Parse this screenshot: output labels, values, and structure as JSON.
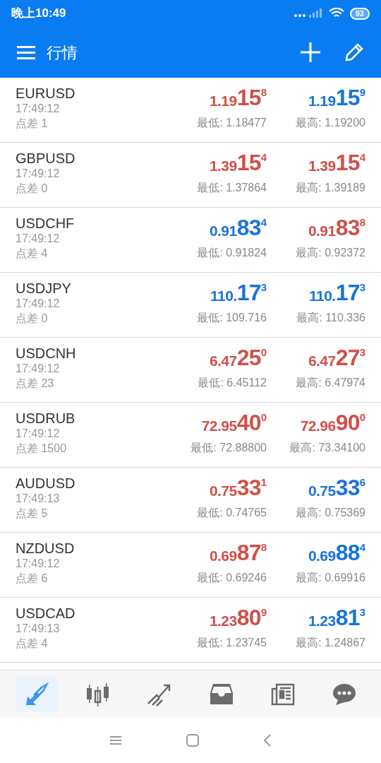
{
  "status_bar": {
    "time": "晚上10:49",
    "battery": "93"
  },
  "app_bar": {
    "title": "行情"
  },
  "quotes": [
    {
      "symbol": "EURUSD",
      "time": "17:49:12",
      "spread": "点差 1",
      "bid": {
        "prefix": "1.19",
        "big": "15",
        "sup": "8",
        "color": "#d0504a"
      },
      "ask": {
        "prefix": "1.19",
        "big": "15",
        "sup": "9",
        "color": "#1a73d9"
      },
      "low": "最低: 1.18477",
      "high": "最高: 1.19200"
    },
    {
      "symbol": "GBPUSD",
      "time": "17:49:12",
      "spread": "点差 0",
      "bid": {
        "prefix": "1.39",
        "big": "15",
        "sup": "4",
        "color": "#d0504a"
      },
      "ask": {
        "prefix": "1.39",
        "big": "15",
        "sup": "4",
        "color": "#d0504a"
      },
      "low": "最低: 1.37864",
      "high": "最高: 1.39189"
    },
    {
      "symbol": "USDCHF",
      "time": "17:49:12",
      "spread": "点差 4",
      "bid": {
        "prefix": "0.91",
        "big": "83",
        "sup": "4",
        "color": "#1a73d9"
      },
      "ask": {
        "prefix": "0.91",
        "big": "83",
        "sup": "8",
        "color": "#d0504a"
      },
      "low": "最低: 0.91824",
      "high": "最高: 0.92372"
    },
    {
      "symbol": "USDJPY",
      "time": "17:49:12",
      "spread": "点差 0",
      "bid": {
        "prefix": "110.",
        "big": "17",
        "sup": "3",
        "color": "#1a73d9"
      },
      "ask": {
        "prefix": "110.",
        "big": "17",
        "sup": "3",
        "color": "#1a73d9"
      },
      "low": "最低: 109.716",
      "high": "最高: 110.336"
    },
    {
      "symbol": "USDCNH",
      "time": "17:49:12",
      "spread": "点差 23",
      "bid": {
        "prefix": "6.47",
        "big": "25",
        "sup": "0",
        "color": "#d0504a"
      },
      "ask": {
        "prefix": "6.47",
        "big": "27",
        "sup": "3",
        "color": "#d0504a"
      },
      "low": "最低: 6.45112",
      "high": "最高: 6.47974"
    },
    {
      "symbol": "USDRUB",
      "time": "17:49:12",
      "spread": "点差 1500",
      "bid": {
        "prefix": "72.95",
        "big": "40",
        "sup": "0",
        "color": "#d0504a"
      },
      "ask": {
        "prefix": "72.96",
        "big": "90",
        "sup": "0",
        "color": "#d0504a"
      },
      "low": "最低: 72.88800",
      "high": "最高: 73.34100"
    },
    {
      "symbol": "AUDUSD",
      "time": "17:49:13",
      "spread": "点差 5",
      "bid": {
        "prefix": "0.75",
        "big": "33",
        "sup": "1",
        "color": "#d0504a"
      },
      "ask": {
        "prefix": "0.75",
        "big": "33",
        "sup": "6",
        "color": "#1a73d9"
      },
      "low": "最低: 0.74765",
      "high": "最高: 0.75369"
    },
    {
      "symbol": "NZDUSD",
      "time": "17:49:12",
      "spread": "点差 6",
      "bid": {
        "prefix": "0.69",
        "big": "87",
        "sup": "8",
        "color": "#d0504a"
      },
      "ask": {
        "prefix": "0.69",
        "big": "88",
        "sup": "4",
        "color": "#1a73d9"
      },
      "low": "最低: 0.69246",
      "high": "最高: 0.69916"
    },
    {
      "symbol": "USDCAD",
      "time": "17:49:13",
      "spread": "点差 4",
      "bid": {
        "prefix": "1.23",
        "big": "80",
        "sup": "9",
        "color": "#d0504a"
      },
      "ask": {
        "prefix": "1.23",
        "big": "81",
        "sup": "3",
        "color": "#1a73d9"
      },
      "low": "最低: 1.23745",
      "high": "最高: 1.24867"
    }
  ],
  "bottom_tabs": [
    {
      "kind": "quotes",
      "selected": true
    },
    {
      "kind": "chart",
      "selected": false
    },
    {
      "kind": "trade",
      "selected": false
    },
    {
      "kind": "history",
      "selected": false
    },
    {
      "kind": "news",
      "selected": false
    },
    {
      "kind": "chat",
      "selected": false
    }
  ]
}
